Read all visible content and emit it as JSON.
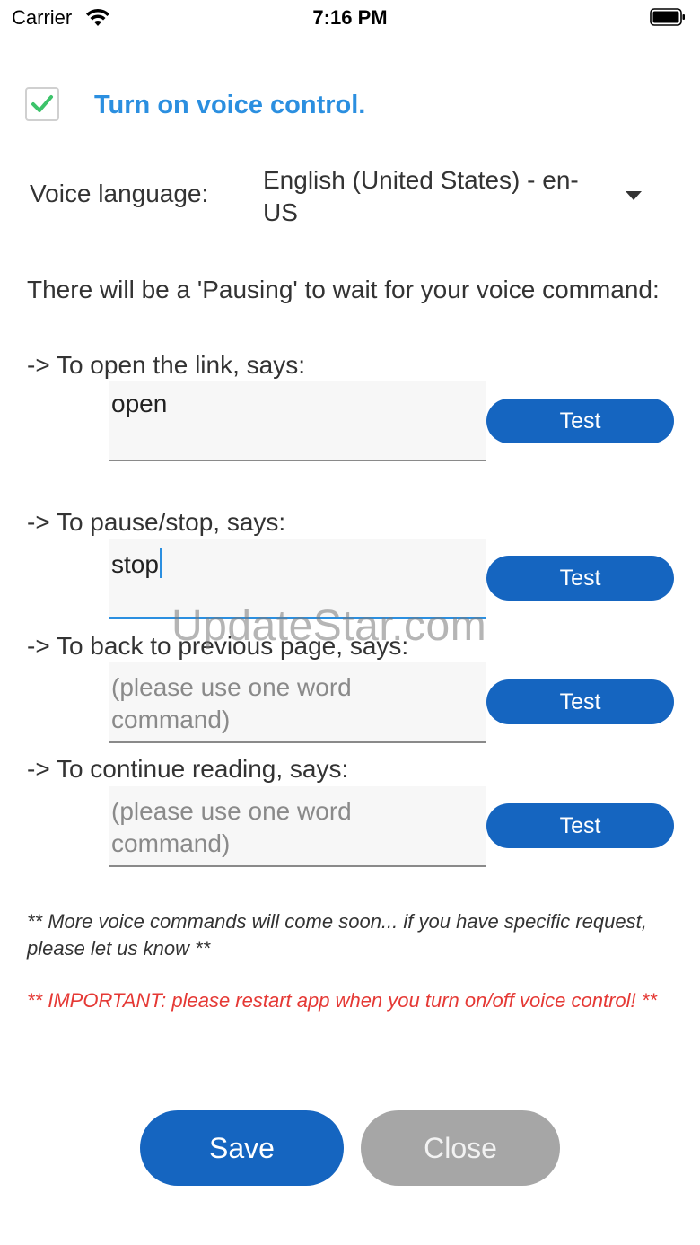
{
  "status_bar": {
    "carrier": "Carrier",
    "time": "7:16 PM"
  },
  "voice_control": {
    "checked": true,
    "label": "Turn on voice control."
  },
  "language": {
    "label": "Voice language:",
    "value": "English (United States) - en-US"
  },
  "intro": "There will be a 'Pausing' to wait for your voice command:",
  "commands": [
    {
      "label": "-> To open the link, says:",
      "value": "open",
      "placeholder": "",
      "test_label": "Test"
    },
    {
      "label": "-> To pause/stop, says:",
      "value": "stop",
      "placeholder": "",
      "test_label": "Test"
    },
    {
      "label": "-> To back to previous page, says:",
      "value": "",
      "placeholder": "(please use one word command)",
      "test_label": "Test"
    },
    {
      "label": "-> To continue reading, says:",
      "value": "",
      "placeholder": "(please use one word command)",
      "test_label": "Test"
    }
  ],
  "notes": {
    "soon": "** More voice  commands will come soon... if you have specific request, please let us know **",
    "important": "** IMPORTANT: please restart app when you turn on/off voice control! **"
  },
  "buttons": {
    "save": "Save",
    "close": "Close"
  },
  "watermark": "UpdateStar.com",
  "colors": {
    "accent": "#1565c0",
    "title_blue": "#2b8fe0",
    "warning": "#e53935",
    "check_green": "#3cc36a"
  }
}
